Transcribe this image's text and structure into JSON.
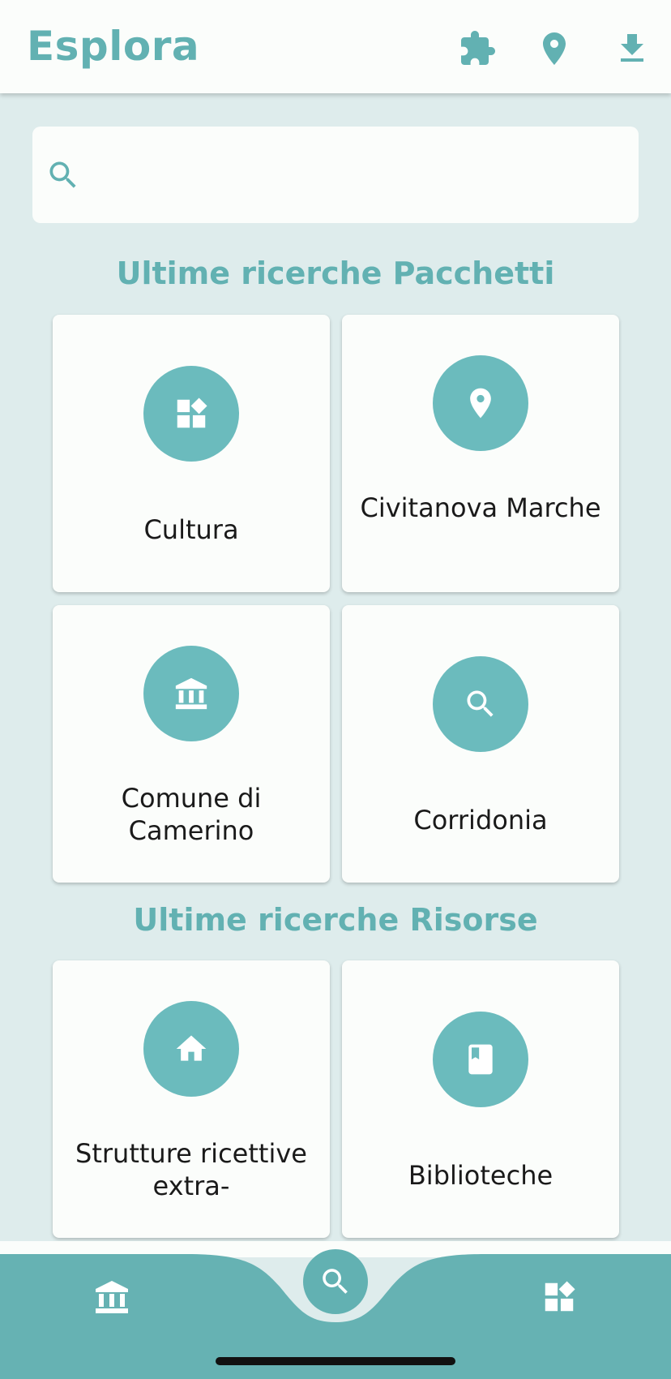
{
  "appbar": {
    "title": "Esplora",
    "actions": [
      "puzzle-icon",
      "location-pin-icon",
      "download-icon"
    ]
  },
  "search": {
    "placeholder": "",
    "value": ""
  },
  "packages": {
    "title": "Ultime ricerche Pacchetti",
    "items": [
      {
        "label": "Cultura",
        "icon": "category-icon"
      },
      {
        "label": "Civitanova Marche",
        "icon": "location-pin-icon"
      },
      {
        "label": "Comune di Camerino",
        "icon": "museum-icon"
      },
      {
        "label": "Corridonia",
        "icon": "search-icon"
      }
    ]
  },
  "resources": {
    "title": "Ultime ricerche Risorse",
    "items": [
      {
        "label": "Strutture ricettive extra-",
        "icon": "home-icon"
      },
      {
        "label": "Biblioteche",
        "icon": "book-icon"
      }
    ]
  },
  "bottom_nav": {
    "items": [
      "museum-icon",
      "search-icon",
      "category-icon"
    ]
  },
  "colors": {
    "accent": "#62b1b2",
    "card_icon_bg": "#6bbbbd",
    "background": "#deecec",
    "surface": "#fbfdfb",
    "bottom_bar": "#66b2b3"
  }
}
